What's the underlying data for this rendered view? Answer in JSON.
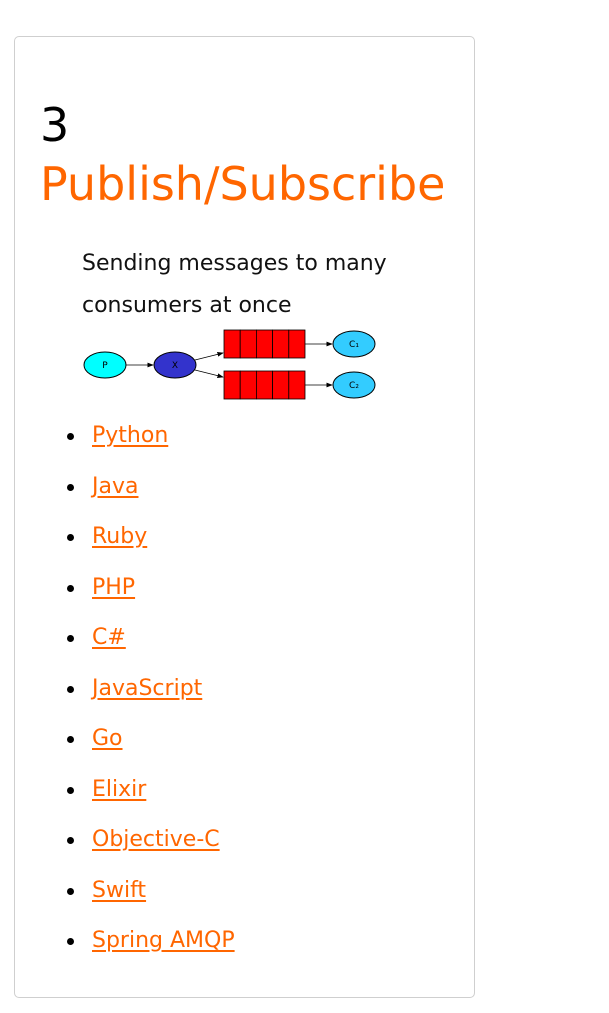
{
  "card": {
    "number": "3",
    "title": "Publish/Subscribe",
    "description": "Sending messages to many consumers at once",
    "diagram": {
      "producer_label": "P",
      "exchange_label": "X",
      "consumers": [
        "C₁",
        "C₂"
      ],
      "queue_slots": 5,
      "colors": {
        "producer": "#00ffff",
        "exchange": "#3333cc",
        "queue": "#ff0000",
        "consumer": "#33ccff"
      }
    },
    "links": [
      {
        "label": "Python"
      },
      {
        "label": "Java"
      },
      {
        "label": "Ruby"
      },
      {
        "label": "PHP"
      },
      {
        "label": "C#"
      },
      {
        "label": "JavaScript"
      },
      {
        "label": "Go"
      },
      {
        "label": "Elixir"
      },
      {
        "label": "Objective-C"
      },
      {
        "label": "Swift"
      },
      {
        "label": "Spring AMQP"
      }
    ]
  },
  "colors": {
    "accent": "#ff6600",
    "border": "#cfcfcf"
  }
}
